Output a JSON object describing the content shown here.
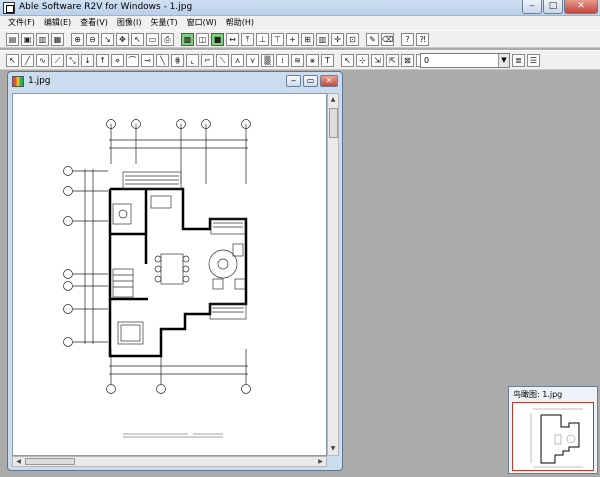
{
  "window": {
    "title": "Able Software R2V for Windows - 1.jpg"
  },
  "menu": {
    "items": [
      "文件(F)",
      "编辑(E)",
      "查看(V)",
      "图像(I)",
      "矢量(T)",
      "窗口(W)",
      "帮助(H)"
    ]
  },
  "toolbar2": {
    "layer_value": "0"
  },
  "document": {
    "title": "1.jpg"
  },
  "preview": {
    "title": "鸟瞰图: 1.jpg"
  }
}
